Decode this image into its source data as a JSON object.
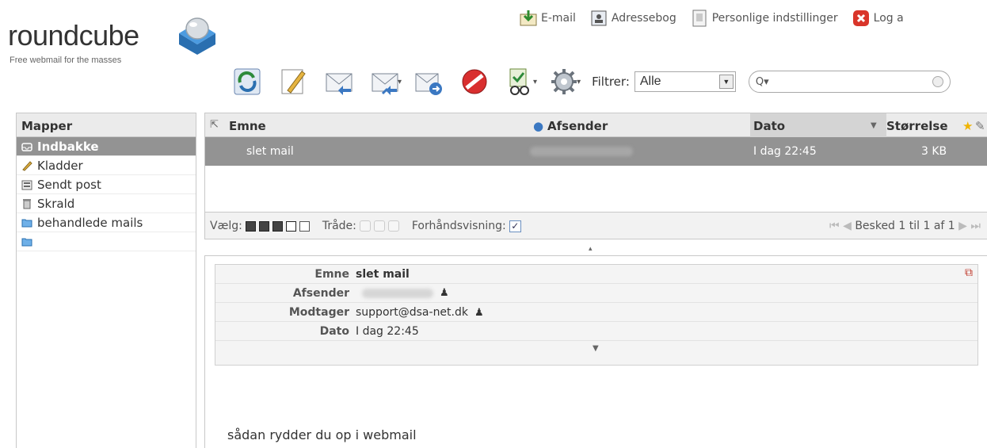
{
  "logo": {
    "name": "roundcube",
    "tagline": "Free webmail for the masses"
  },
  "toplinks": [
    {
      "label": "E-mail",
      "icon": "mail-download-icon"
    },
    {
      "label": "Adressebog",
      "icon": "addressbook-icon"
    },
    {
      "label": "Personlige indstillinger",
      "icon": "settings-icon"
    },
    {
      "label": "Log a",
      "icon": "logout-icon"
    }
  ],
  "toolbar": {
    "buttons": [
      "refresh-icon",
      "compose-icon",
      "reply-icon",
      "reply-all-icon",
      "forward-icon",
      "delete-icon",
      "mark-icon",
      "more-gear-icon"
    ],
    "filter_label": "Filtrer:",
    "filter_value": "Alle",
    "search_value": ""
  },
  "folders": {
    "title": "Mapper",
    "items": [
      {
        "label": "Indbakke",
        "active": true
      },
      {
        "label": "Kladder"
      },
      {
        "label": "Sendt post"
      },
      {
        "label": "Skrald"
      },
      {
        "label": "behandlede mails"
      },
      {
        "label": ""
      }
    ]
  },
  "message_list": {
    "columns": {
      "subject": "Emne",
      "sender": "Afsender",
      "date": "Dato",
      "size": "Størrelse"
    },
    "rows": [
      {
        "subject": "slet mail",
        "sender": "",
        "date": "I dag 22:45",
        "size": "3 KB"
      }
    ],
    "footer": {
      "select_label": "Vælg:",
      "threads_label": "Tråde:",
      "preview_label": "Forhåndsvisning:",
      "preview_checked": true,
      "pager_text": "Besked 1 til 1 af 1"
    }
  },
  "preview": {
    "headers": [
      {
        "label": "Emne",
        "value": "slet mail"
      },
      {
        "label": "Afsender",
        "value": ""
      },
      {
        "label": "Modtager",
        "value": "support@dsa-net.dk"
      },
      {
        "label": "Dato",
        "value": "I dag 22:45"
      }
    ],
    "body": "sådan rydder du op i webmail"
  }
}
